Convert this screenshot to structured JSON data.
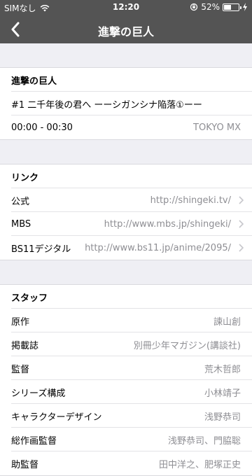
{
  "status_bar": {
    "carrier": "SIMなし",
    "time": "12:20",
    "battery_percent": "52%",
    "battery_level": 0.52
  },
  "nav": {
    "title": "進撃の巨人"
  },
  "program": {
    "title": "進撃の巨人",
    "episode": "#1 二千年後の君へ ーーシガンシナ陥落①ーー",
    "time_range": "00:00 - 00:30",
    "channel": "TOKYO MX"
  },
  "links": {
    "header": "リンク",
    "items": [
      {
        "label": "公式",
        "url": "http://shingeki.tv/"
      },
      {
        "label": "MBS",
        "url": "http://www.mbs.jp/shingeki/"
      },
      {
        "label": "BS11デジタル",
        "url": "http://www.bs11.jp/anime/2095/"
      }
    ]
  },
  "staff": {
    "header": "スタッフ",
    "items": [
      {
        "role": "原作",
        "name": "諫山創"
      },
      {
        "role": "掲載誌",
        "name": "別冊少年マガジン(講談社)"
      },
      {
        "role": "監督",
        "name": "荒木哲郎"
      },
      {
        "role": "シリーズ構成",
        "name": "小林靖子"
      },
      {
        "role": "キャラクターデザイン",
        "name": "浅野恭司"
      },
      {
        "role": "総作画監督",
        "name": "浅野恭司、門脇聡"
      },
      {
        "role": "助監督",
        "name": "田中洋之、肥塚正史"
      }
    ]
  }
}
